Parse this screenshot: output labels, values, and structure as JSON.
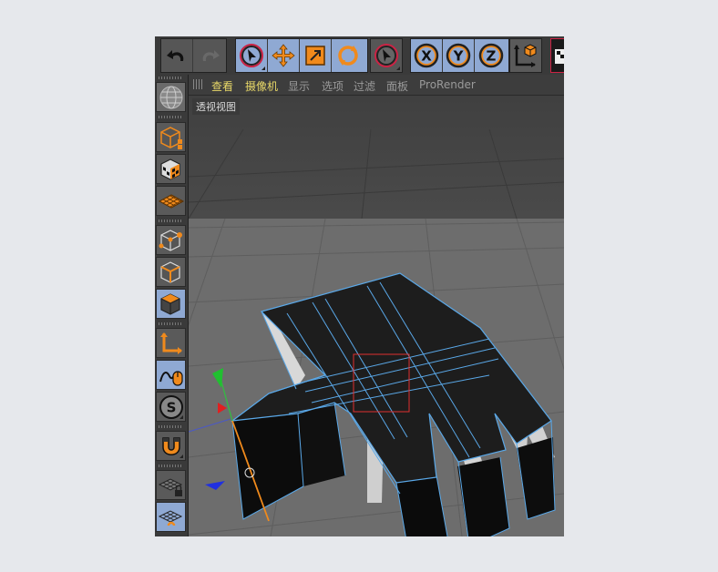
{
  "viewport": {
    "menu": [
      {
        "label": "查看",
        "active": true
      },
      {
        "label": "摄像机",
        "active": true
      },
      {
        "label": "显示",
        "active": false
      },
      {
        "label": "选项",
        "active": false
      },
      {
        "label": "过滤",
        "active": false
      },
      {
        "label": "面板",
        "active": false
      },
      {
        "label": "ProRender",
        "active": false
      }
    ],
    "view_name": "透视视图"
  },
  "toolbar": {
    "undo_icon": "undo-icon",
    "redo_icon": "redo-icon",
    "tools": [
      "live-selection-icon",
      "move-icon",
      "scale-icon",
      "rotate-icon",
      "recent-tool-icon"
    ],
    "axis_labels": [
      "X",
      "Y",
      "Z"
    ],
    "coord_system_icon": "world-coordinate-icon",
    "render_icon": "render-view-icon"
  },
  "palette": {
    "icons": [
      "view-sphere-icon",
      "model-mode-icon",
      "texture-mode-icon",
      "workplane-icon",
      "points-mode-icon",
      "edges-mode-icon",
      "polygons-mode-icon",
      "axis-mode-icon",
      "tweak-mode-icon",
      "solo-icon",
      "snap-magnet-icon",
      "locked-workplane-icon",
      "planar-workplane-icon"
    ]
  },
  "colors": {
    "accent_orange": "#f08a1c",
    "selection_blue": "#8fa9d3",
    "axis_x": "#e02020",
    "axis_y": "#20c030",
    "axis_z": "#2030e0",
    "edge_highlight": "#5aa8e8",
    "selection_box": "#e03030"
  }
}
